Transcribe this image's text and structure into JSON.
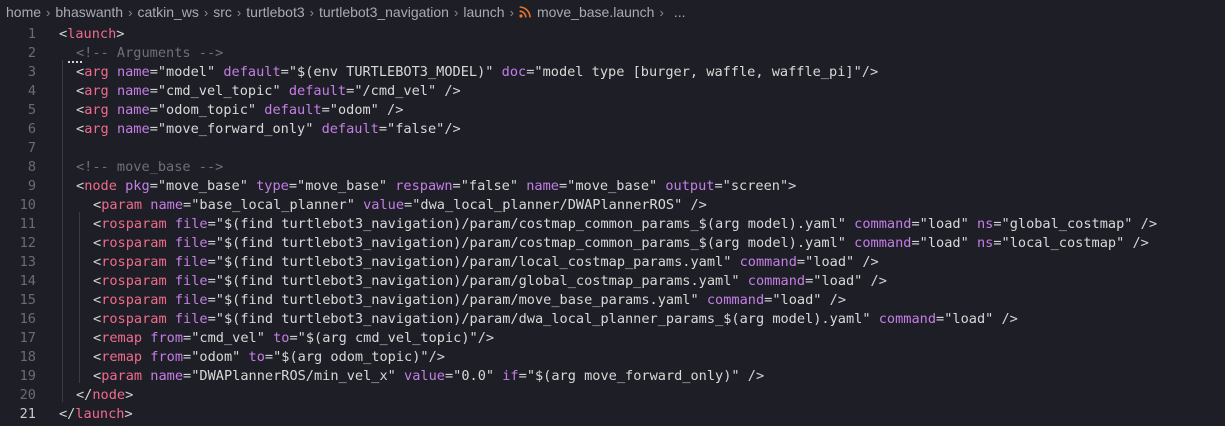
{
  "breadcrumb": {
    "items": [
      "home",
      "bhaswanth",
      "catkin_ws",
      "src",
      "turtlebot3",
      "turtlebot3_navigation",
      "launch"
    ],
    "file": "move_base.launch",
    "ellipsis": "..."
  },
  "editor": {
    "active_line": 21,
    "lines": [
      {
        "n": "1",
        "indent": 0,
        "tokens": [
          [
            "p",
            "<"
          ],
          [
            "tag",
            "launch"
          ],
          [
            "p",
            ">"
          ]
        ]
      },
      {
        "n": "2",
        "indent": 1,
        "tokens": [
          [
            "com",
            "<!-- Arguments -->"
          ]
        ]
      },
      {
        "n": "3",
        "indent": 1,
        "tokens": [
          [
            "p",
            "<"
          ],
          [
            "tag",
            "arg"
          ],
          [
            "p",
            " "
          ],
          [
            "attr",
            "name"
          ],
          [
            "p",
            "="
          ],
          [
            "str",
            "\"model\""
          ],
          [
            "p",
            " "
          ],
          [
            "attr",
            "default"
          ],
          [
            "p",
            "="
          ],
          [
            "str",
            "\"$(env TURTLEBOT3_MODEL)\""
          ],
          [
            "p",
            " "
          ],
          [
            "attr",
            "doc"
          ],
          [
            "p",
            "="
          ],
          [
            "str",
            "\"model type [burger, waffle, waffle_pi]\""
          ],
          [
            "p",
            "/>"
          ]
        ]
      },
      {
        "n": "4",
        "indent": 1,
        "tokens": [
          [
            "p",
            "<"
          ],
          [
            "tag",
            "arg"
          ],
          [
            "p",
            " "
          ],
          [
            "attr",
            "name"
          ],
          [
            "p",
            "="
          ],
          [
            "str",
            "\"cmd_vel_topic\""
          ],
          [
            "p",
            " "
          ],
          [
            "attr",
            "default"
          ],
          [
            "p",
            "="
          ],
          [
            "str",
            "\"/cmd_vel\""
          ],
          [
            "p",
            " />"
          ]
        ]
      },
      {
        "n": "5",
        "indent": 1,
        "tokens": [
          [
            "p",
            "<"
          ],
          [
            "tag",
            "arg"
          ],
          [
            "p",
            " "
          ],
          [
            "attr",
            "name"
          ],
          [
            "p",
            "="
          ],
          [
            "str",
            "\"odom_topic\""
          ],
          [
            "p",
            " "
          ],
          [
            "attr",
            "default"
          ],
          [
            "p",
            "="
          ],
          [
            "str",
            "\"odom\""
          ],
          [
            "p",
            " />"
          ]
        ]
      },
      {
        "n": "6",
        "indent": 1,
        "tokens": [
          [
            "p",
            "<"
          ],
          [
            "tag",
            "arg"
          ],
          [
            "p",
            " "
          ],
          [
            "attr",
            "name"
          ],
          [
            "p",
            "="
          ],
          [
            "str",
            "\"move_forward_only\""
          ],
          [
            "p",
            " "
          ],
          [
            "attr",
            "default"
          ],
          [
            "p",
            "="
          ],
          [
            "str",
            "\"false\""
          ],
          [
            "p",
            "/>"
          ]
        ]
      },
      {
        "n": "7",
        "indent": 1,
        "tokens": []
      },
      {
        "n": "8",
        "indent": 1,
        "tokens": [
          [
            "com",
            "<!-- move_base -->"
          ]
        ]
      },
      {
        "n": "9",
        "indent": 1,
        "tokens": [
          [
            "p",
            "<"
          ],
          [
            "tag",
            "node"
          ],
          [
            "p",
            " "
          ],
          [
            "attr",
            "pkg"
          ],
          [
            "p",
            "="
          ],
          [
            "str",
            "\"move_base\""
          ],
          [
            "p",
            " "
          ],
          [
            "attr",
            "type"
          ],
          [
            "p",
            "="
          ],
          [
            "str",
            "\"move_base\""
          ],
          [
            "p",
            " "
          ],
          [
            "attr",
            "respawn"
          ],
          [
            "p",
            "="
          ],
          [
            "str",
            "\"false\""
          ],
          [
            "p",
            " "
          ],
          [
            "attr",
            "name"
          ],
          [
            "p",
            "="
          ],
          [
            "str",
            "\"move_base\""
          ],
          [
            "p",
            " "
          ],
          [
            "attr",
            "output"
          ],
          [
            "p",
            "="
          ],
          [
            "str",
            "\"screen\""
          ],
          [
            "p",
            ">"
          ]
        ]
      },
      {
        "n": "10",
        "indent": 2,
        "tokens": [
          [
            "p",
            "<"
          ],
          [
            "tag",
            "param"
          ],
          [
            "p",
            " "
          ],
          [
            "attr",
            "name"
          ],
          [
            "p",
            "="
          ],
          [
            "str",
            "\"base_local_planner\""
          ],
          [
            "p",
            " "
          ],
          [
            "attr",
            "value"
          ],
          [
            "p",
            "="
          ],
          [
            "str",
            "\"dwa_local_planner/DWAPlannerROS\""
          ],
          [
            "p",
            " />"
          ]
        ]
      },
      {
        "n": "11",
        "indent": 2,
        "tokens": [
          [
            "p",
            "<"
          ],
          [
            "tag",
            "rosparam"
          ],
          [
            "p",
            " "
          ],
          [
            "attr",
            "file"
          ],
          [
            "p",
            "="
          ],
          [
            "str",
            "\"$(find turtlebot3_navigation)/param/costmap_common_params_$(arg model).yaml\""
          ],
          [
            "p",
            " "
          ],
          [
            "attr",
            "command"
          ],
          [
            "p",
            "="
          ],
          [
            "str",
            "\"load\""
          ],
          [
            "p",
            " "
          ],
          [
            "attr",
            "ns"
          ],
          [
            "p",
            "="
          ],
          [
            "str",
            "\"global_costmap\""
          ],
          [
            "p",
            " />"
          ]
        ]
      },
      {
        "n": "12",
        "indent": 2,
        "tokens": [
          [
            "p",
            "<"
          ],
          [
            "tag",
            "rosparam"
          ],
          [
            "p",
            " "
          ],
          [
            "attr",
            "file"
          ],
          [
            "p",
            "="
          ],
          [
            "str",
            "\"$(find turtlebot3_navigation)/param/costmap_common_params_$(arg model).yaml\""
          ],
          [
            "p",
            " "
          ],
          [
            "attr",
            "command"
          ],
          [
            "p",
            "="
          ],
          [
            "str",
            "\"load\""
          ],
          [
            "p",
            " "
          ],
          [
            "attr",
            "ns"
          ],
          [
            "p",
            "="
          ],
          [
            "str",
            "\"local_costmap\""
          ],
          [
            "p",
            " />"
          ]
        ]
      },
      {
        "n": "13",
        "indent": 2,
        "tokens": [
          [
            "p",
            "<"
          ],
          [
            "tag",
            "rosparam"
          ],
          [
            "p",
            " "
          ],
          [
            "attr",
            "file"
          ],
          [
            "p",
            "="
          ],
          [
            "str",
            "\"$(find turtlebot3_navigation)/param/local_costmap_params.yaml\""
          ],
          [
            "p",
            " "
          ],
          [
            "attr",
            "command"
          ],
          [
            "p",
            "="
          ],
          [
            "str",
            "\"load\""
          ],
          [
            "p",
            " />"
          ]
        ]
      },
      {
        "n": "14",
        "indent": 2,
        "tokens": [
          [
            "p",
            "<"
          ],
          [
            "tag",
            "rosparam"
          ],
          [
            "p",
            " "
          ],
          [
            "attr",
            "file"
          ],
          [
            "p",
            "="
          ],
          [
            "str",
            "\"$(find turtlebot3_navigation)/param/global_costmap_params.yaml\""
          ],
          [
            "p",
            " "
          ],
          [
            "attr",
            "command"
          ],
          [
            "p",
            "="
          ],
          [
            "str",
            "\"load\""
          ],
          [
            "p",
            " />"
          ]
        ]
      },
      {
        "n": "15",
        "indent": 2,
        "tokens": [
          [
            "p",
            "<"
          ],
          [
            "tag",
            "rosparam"
          ],
          [
            "p",
            " "
          ],
          [
            "attr",
            "file"
          ],
          [
            "p",
            "="
          ],
          [
            "str",
            "\"$(find turtlebot3_navigation)/param/move_base_params.yaml\""
          ],
          [
            "p",
            " "
          ],
          [
            "attr",
            "command"
          ],
          [
            "p",
            "="
          ],
          [
            "str",
            "\"load\""
          ],
          [
            "p",
            " />"
          ]
        ]
      },
      {
        "n": "16",
        "indent": 2,
        "tokens": [
          [
            "p",
            "<"
          ],
          [
            "tag",
            "rosparam"
          ],
          [
            "p",
            " "
          ],
          [
            "attr",
            "file"
          ],
          [
            "p",
            "="
          ],
          [
            "str",
            "\"$(find turtlebot3_navigation)/param/dwa_local_planner_params_$(arg model).yaml\""
          ],
          [
            "p",
            " "
          ],
          [
            "attr",
            "command"
          ],
          [
            "p",
            "="
          ],
          [
            "str",
            "\"load\""
          ],
          [
            "p",
            " />"
          ]
        ]
      },
      {
        "n": "17",
        "indent": 2,
        "tokens": [
          [
            "p",
            "<"
          ],
          [
            "tag",
            "remap"
          ],
          [
            "p",
            " "
          ],
          [
            "attr",
            "from"
          ],
          [
            "p",
            "="
          ],
          [
            "str",
            "\"cmd_vel\""
          ],
          [
            "p",
            " "
          ],
          [
            "attr",
            "to"
          ],
          [
            "p",
            "="
          ],
          [
            "str",
            "\"$(arg cmd_vel_topic)\""
          ],
          [
            "p",
            "/>"
          ]
        ]
      },
      {
        "n": "18",
        "indent": 2,
        "tokens": [
          [
            "p",
            "<"
          ],
          [
            "tag",
            "remap"
          ],
          [
            "p",
            " "
          ],
          [
            "attr",
            "from"
          ],
          [
            "p",
            "="
          ],
          [
            "str",
            "\"odom\""
          ],
          [
            "p",
            " "
          ],
          [
            "attr",
            "to"
          ],
          [
            "p",
            "="
          ],
          [
            "str",
            "\"$(arg odom_topic)\""
          ],
          [
            "p",
            "/>"
          ]
        ]
      },
      {
        "n": "19",
        "indent": 2,
        "tokens": [
          [
            "p",
            "<"
          ],
          [
            "tag",
            "param"
          ],
          [
            "p",
            " "
          ],
          [
            "attr",
            "name"
          ],
          [
            "p",
            "="
          ],
          [
            "str",
            "\"DWAPlannerROS/min_vel_x\""
          ],
          [
            "p",
            " "
          ],
          [
            "attr",
            "value"
          ],
          [
            "p",
            "="
          ],
          [
            "str",
            "\"0.0\""
          ],
          [
            "p",
            " "
          ],
          [
            "attr",
            "if"
          ],
          [
            "p",
            "="
          ],
          [
            "str",
            "\"$(arg move_forward_only)\""
          ],
          [
            "p",
            " />"
          ]
        ]
      },
      {
        "n": "20",
        "indent": 1,
        "tokens": [
          [
            "p",
            "</"
          ],
          [
            "tag",
            "node"
          ],
          [
            "p",
            ">"
          ]
        ]
      },
      {
        "n": "21",
        "indent": 0,
        "tokens": [
          [
            "p",
            "</"
          ],
          [
            "tag",
            "launch"
          ],
          [
            "p",
            ">"
          ]
        ]
      }
    ]
  },
  "colors": {
    "background": "#1e1f26",
    "tag": "#f06b8c",
    "attribute": "#c57ee6",
    "string": "#d8d8d8",
    "comment": "#6e7079",
    "line_number": "#6a6c75",
    "rss_icon": "#e8762b"
  },
  "icons": {
    "breadcrumb_separator": "chevron-right-icon",
    "file_type": "rss-icon"
  }
}
